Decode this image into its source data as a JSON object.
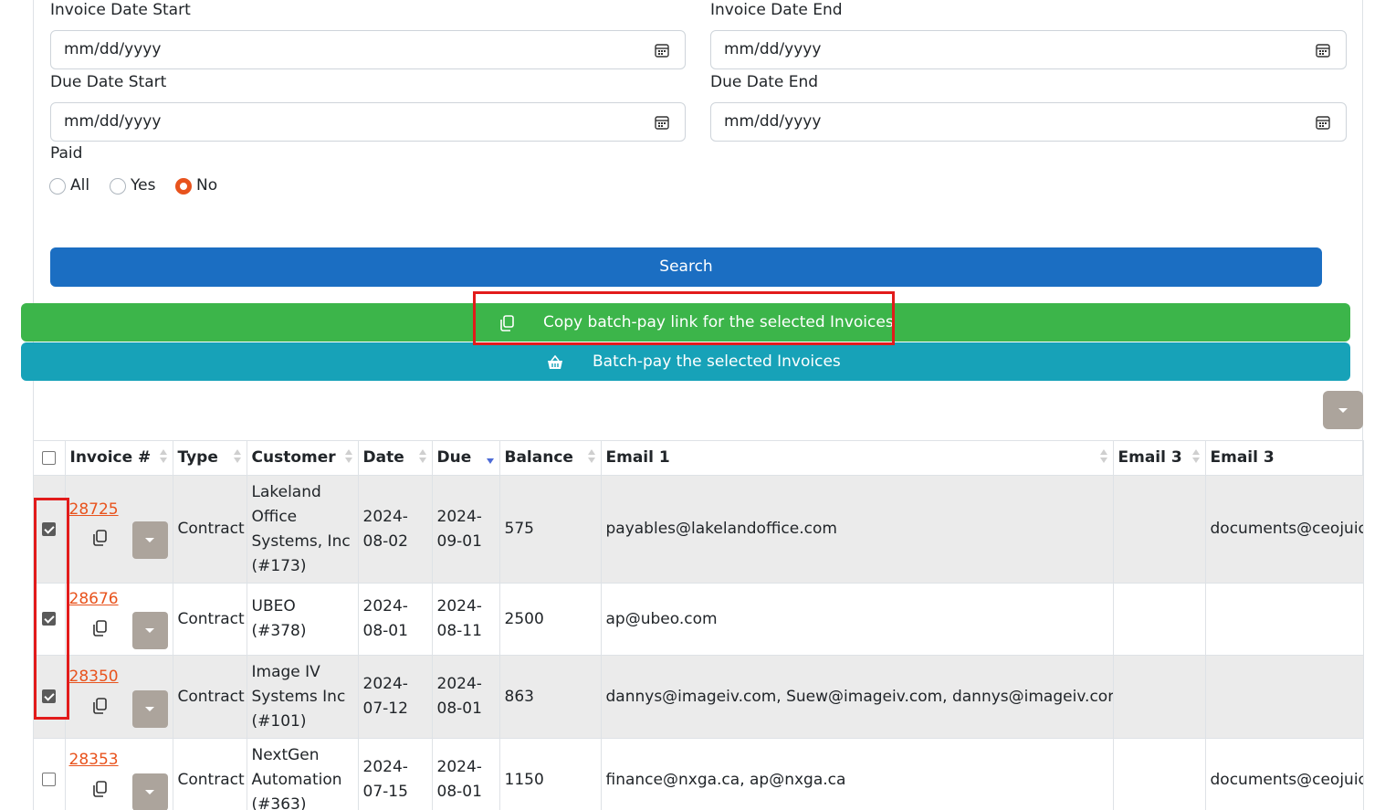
{
  "filters": {
    "invoice_date_start": {
      "label": "Invoice Date Start",
      "value": "mm/dd/yyyy"
    },
    "invoice_date_end": {
      "label": "Invoice Date End",
      "value": "mm/dd/yyyy"
    },
    "due_date_start": {
      "label": "Due Date Start",
      "value": "mm/dd/yyyy"
    },
    "due_date_end": {
      "label": "Due Date End",
      "value": "mm/dd/yyyy"
    },
    "paid": {
      "label": "Paid",
      "options": [
        "All",
        "Yes",
        "No"
      ],
      "selected": "No"
    }
  },
  "buttons": {
    "search": "Search",
    "copy_batch": "Copy batch-pay link for the selected Invoices",
    "batch_pay": "Batch-pay the selected Invoices"
  },
  "colors": {
    "search": "#1b6ec2",
    "copy_batch": "#3cb54a",
    "batch_pay": "#17a2b8",
    "accent": "#e8531d",
    "highlight": "#e21b1b"
  },
  "table": {
    "headers": [
      "Invoice #",
      "Type",
      "Customer",
      "Date",
      "Due",
      "Balance",
      "Email 1",
      "Email 3",
      "Email 3"
    ],
    "sorted_column": "Due",
    "rows": [
      {
        "checked": true,
        "invoice": "28725",
        "type": "Contract",
        "customer": "Lakeland Office Systems, Inc (#173)",
        "date": "2024-08-02",
        "due": "2024-09-01",
        "balance": "575",
        "email1": "payables@lakelandoffice.com",
        "email2": "",
        "email3": "documents@ceojuice"
      },
      {
        "checked": true,
        "invoice": "28676",
        "type": "Contract",
        "customer": "UBEO (#378)",
        "date": "2024-08-01",
        "due": "2024-08-11",
        "balance": "2500",
        "email1": "ap@ubeo.com",
        "email2": "",
        "email3": ""
      },
      {
        "checked": true,
        "invoice": "28350",
        "type": "Contract",
        "customer": "Image IV Systems Inc (#101)",
        "date": "2024-07-12",
        "due": "2024-08-01",
        "balance": "863",
        "email1": "dannys@imageiv.com, Suew@imageiv.com, dannys@imageiv.com",
        "email2": "",
        "email3": ""
      },
      {
        "checked": false,
        "invoice": "28353",
        "type": "Contract",
        "customer": "NextGen Automation (#363)",
        "date": "2024-07-15",
        "due": "2024-08-01",
        "balance": "1150",
        "email1": "finance@nxga.ca, ap@nxga.ca",
        "email2": "",
        "email3": "documents@ceojuice"
      }
    ]
  }
}
